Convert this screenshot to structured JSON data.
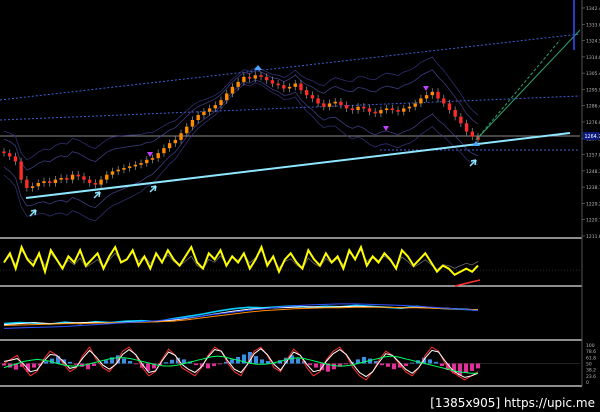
{
  "watermark": "[1385x905] https://upic.me",
  "colors": {
    "background": "#000000",
    "bull_candle": "#ff8c00",
    "bear_candle": "#ff2a2a",
    "trendline": "#8fe6ff",
    "dotted_line": "#3f5fd0",
    "oscillator": "#ffff00",
    "hist_pos": "#3b8fe0",
    "hist_neg": "#e0309a",
    "axis_text": "#b8b8b8",
    "price_box": "#0b1a80",
    "panel_border": "#e0e0e0"
  },
  "chart_data": [
    {
      "type": "candlestick",
      "y_axis_ticks": [
        "1342.4",
        "1333.0",
        "1324.5",
        "1314.0",
        "1305.4",
        "1295.9",
        "1286.4",
        "1276.8",
        "1267.3",
        "1257.8",
        "1248.3",
        "1238.7",
        "1229.2",
        "1220.7",
        "1211.6"
      ],
      "current_price": "1264.7",
      "ylim": [
        1206,
        1346
      ],
      "close": [
        1256,
        1254,
        1251,
        1240,
        1235,
        1236,
        1238,
        1239,
        1238,
        1240,
        1241,
        1240,
        1243,
        1242,
        1240,
        1238,
        1237,
        1240,
        1243,
        1245,
        1246,
        1247,
        1248,
        1249,
        1250,
        1252,
        1253,
        1256,
        1259,
        1262,
        1264,
        1268,
        1272,
        1276,
        1279,
        1281,
        1283,
        1285,
        1288,
        1292,
        1296,
        1299,
        1302,
        1301,
        1303,
        1302,
        1300,
        1298,
        1297,
        1295,
        1296,
        1298,
        1294,
        1291,
        1289,
        1286,
        1284,
        1286,
        1287,
        1285,
        1283,
        1282,
        1284,
        1283,
        1281,
        1280,
        1282,
        1283,
        1282,
        1281,
        1283,
        1284,
        1286,
        1289,
        1291,
        1293,
        1289,
        1286,
        1282,
        1278,
        1274,
        1269,
        1266,
        1264
      ],
      "notes": "Price series read off the chart by eye; individual bar values are approximate."
    },
    {
      "type": "line",
      "name": "",
      "ylim": [
        -2,
        12
      ],
      "values": [
        5,
        8,
        3,
        10,
        6,
        4,
        8,
        2,
        9,
        6,
        3,
        7,
        5,
        9,
        4,
        6,
        8,
        3,
        7,
        10,
        5,
        6,
        9,
        4,
        7,
        3,
        8,
        5,
        9,
        6,
        4,
        7,
        10,
        5,
        3,
        8,
        6,
        9,
        4,
        7,
        5,
        8,
        3,
        6,
        10,
        4,
        7,
        2,
        6,
        8,
        5,
        3,
        9,
        6,
        4,
        8,
        5,
        7,
        3,
        9,
        6,
        10,
        4,
        7,
        5,
        8,
        6,
        3,
        9,
        7,
        4,
        6,
        8,
        5,
        2,
        4,
        3,
        1,
        2,
        3,
        2,
        4
      ]
    },
    {
      "type": "line",
      "name": "",
      "ylim": [
        0,
        10
      ],
      "series": [
        {
          "color": "#00d0ff",
          "values": [
            3,
            3.2,
            3.1,
            2.9,
            3.3,
            3,
            3.4,
            3.2,
            3.5,
            3.6,
            3.4,
            4,
            4.5,
            5,
            5.6,
            6.1,
            6.4,
            6.3,
            6.5,
            6.7,
            6.4,
            6.6,
            6.5,
            6.8,
            6.6,
            6.4,
            6.2,
            6.6,
            6.3,
            6.1,
            6.0,
            5.8
          ]
        },
        {
          "color": "#ffffff",
          "values": [
            2.8,
            3,
            3.2,
            3,
            3.1,
            3.2,
            3.3,
            3.1,
            3.3,
            3.4,
            3.5,
            3.7,
            4.1,
            4.6,
            5.1,
            5.6,
            6.0,
            6.2,
            6.3,
            6.4,
            6.5,
            6.4,
            6.5,
            6.6,
            6.5,
            6.4,
            6.3,
            6.4,
            6.3,
            6.2,
            6.0,
            5.9
          ]
        },
        {
          "color": "#ff8c00",
          "values": [
            2.6,
            2.7,
            2.8,
            2.9,
            3.0,
            3.0,
            3.1,
            3.2,
            3.2,
            3.3,
            3.4,
            3.5,
            3.8,
            4.2,
            4.6,
            5.0,
            5.4,
            5.7,
            5.9,
            6.1,
            6.2,
            6.3,
            6.3,
            6.4,
            6.4,
            6.4,
            6.3,
            6.3,
            6.2,
            6.1,
            6.0,
            5.9
          ]
        },
        {
          "color": "#3050ff",
          "values": [
            2.0,
            2.1,
            2.2,
            2.3,
            2.4,
            2.6,
            2.8,
            3.0,
            3.2,
            3.4,
            3.6,
            3.9,
            4.2,
            4.6,
            5.0,
            5.4,
            5.8,
            6.1,
            6.4,
            6.7,
            6.9,
            7.0,
            7.1,
            7.1,
            7.0,
            6.9,
            6.8,
            6.6,
            6.4,
            6.2,
            6.0,
            5.7
          ]
        }
      ]
    },
    {
      "type": "bar",
      "name": "",
      "y_axis_ticks": [
        "100",
        "78.6",
        "61.8",
        "50",
        "38.2",
        "23.6",
        "0"
      ],
      "ylim": [
        -50,
        50
      ],
      "values": [
        -5,
        -10,
        -15,
        -8,
        -20,
        -10,
        -5,
        5,
        12,
        18,
        10,
        4,
        -3,
        -8,
        -14,
        -6,
        2,
        8,
        15,
        20,
        12,
        6,
        -2,
        -10,
        -18,
        -12,
        -4,
        3,
        9,
        14,
        10,
        5,
        -4,
        -8,
        -12,
        -6,
        -2,
        4,
        10,
        16,
        22,
        28,
        18,
        10,
        6,
        2,
        8,
        14,
        20,
        12,
        6,
        -4,
        -10,
        -16,
        -20,
        -14,
        -8,
        -2,
        4,
        10,
        16,
        12,
        6,
        -4,
        -8,
        -14,
        -10,
        -6,
        2,
        8,
        14,
        10,
        4,
        -6,
        -16,
        -24,
        -28,
        -22,
        -18,
        -12
      ],
      "curves": [
        {
          "color": "#ff3030",
          "ylim": [
            0,
            100
          ],
          "values": [
            50,
            60,
            70,
            40,
            20,
            30,
            60,
            80,
            70,
            50,
            30,
            40,
            70,
            90,
            60,
            40,
            30,
            50,
            80,
            90,
            70,
            40,
            20,
            30,
            60,
            85,
            70,
            40,
            30,
            20,
            40,
            70,
            90,
            80,
            50,
            30,
            20,
            50,
            80,
            90,
            70,
            40,
            30,
            60,
            85,
            70,
            40,
            20,
            30,
            60,
            80,
            90,
            70,
            40,
            20,
            10,
            30,
            60,
            80,
            70,
            50,
            30,
            20,
            40,
            70,
            90,
            80,
            50,
            30,
            20,
            10,
            20,
            30
          ]
        },
        {
          "color": "#ffffff",
          "ylim": [
            0,
            100
          ],
          "values": [
            55,
            58,
            62,
            48,
            30,
            34,
            55,
            72,
            70,
            55,
            38,
            42,
            64,
            82,
            66,
            46,
            36,
            48,
            72,
            84,
            72,
            48,
            28,
            32,
            56,
            78,
            70,
            48,
            36,
            28,
            42,
            66,
            84,
            80,
            56,
            36,
            28,
            48,
            74,
            86,
            72,
            48,
            34,
            56,
            78,
            70,
            48,
            30,
            34,
            56,
            74,
            84,
            72,
            48,
            28,
            18,
            30,
            54,
            74,
            70,
            54,
            36,
            26,
            40,
            64,
            82,
            78,
            56,
            36,
            24,
            16,
            20,
            26
          ]
        },
        {
          "color": "#00ff60",
          "ylim": [
            0,
            100
          ],
          "values": [
            40,
            45,
            50,
            55,
            58,
            60,
            58,
            55,
            50,
            46,
            44,
            44,
            46,
            50,
            54,
            58,
            62,
            64,
            64,
            62,
            58,
            54,
            50,
            46,
            44,
            44,
            46,
            50,
            54,
            58,
            62,
            66,
            68,
            66,
            62,
            58,
            54,
            50,
            48,
            48,
            50,
            54,
            58,
            62,
            64,
            62,
            58,
            54,
            50,
            46,
            44,
            44,
            46,
            50,
            54,
            58,
            62,
            66,
            68,
            66,
            62,
            58,
            54,
            50,
            46,
            42,
            38,
            34,
            30,
            28,
            26,
            26
          ]
        }
      ]
    }
  ]
}
